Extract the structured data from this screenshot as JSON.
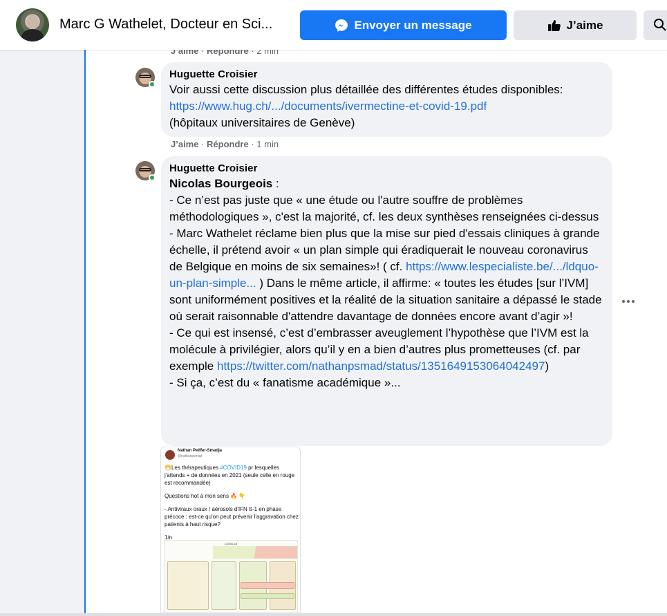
{
  "header": {
    "page_name": "Marc G Wathelet, Docteur en Sci...",
    "message_button": "Envoyer un message",
    "like_button": "J’aime"
  },
  "top_meta": {
    "like": "J’aime",
    "reply": "Répondre",
    "time": "2 min"
  },
  "comments": [
    {
      "author": "Huguette Croisier",
      "text_before_link": "Voir aussi cette discussion plus détaillée des différentes études disponibles: ",
      "link": "https://www.hug.ch/.../documents/ivermectine-et-covid-19.pdf",
      "text_after_link": "(hôpitaux universitaires de Genève)",
      "meta": {
        "like": "J’aime",
        "reply": "Répondre",
        "time": "1 min"
      }
    },
    {
      "author": "Huguette Croisier",
      "mention": "Nicolas Bourgeois",
      "mention_suffix": " :",
      "para1": "- Ce n’est pas juste que « une étude ou l'autre souffre de problèmes méthodologiques », c'est la majorité, cf. les deux synthèses renseignées ci-dessus",
      "para2_before_link": "- Marc Wathelet réclame bien plus que la mise sur pied d'essais cliniques à grande échelle, il prétend avoir « un plan simple qui éradiquerait le nouveau coronavirus de Belgique en moins de six semaines»! ( cf. ",
      "para2_link": "https://www.lespecialiste.be/.../ldquo-un-plan-simple...",
      "para2_after_link": " ) Dans le même article, il affirme: « toutes les études [sur l’IVM] sont uniformément positives et la réalité de la situation sanitaire a dépassé le stade où serait raisonnable d'attendre davantage de données encore avant d’agir »!",
      "para3_before_link": "- Ce qui est insensé, c’est d’embrasser aveuglement l’hypothèse que l’IVM est la molécule à privilégier, alors qu’il y en a bien d’autres plus prometteuses (cf. par exemple ",
      "para3_link": "https://twitter.com/nathanpsmad/status/1351649153064042497",
      "para3_after_link": ")",
      "para4": "- Si ça, c’est du « fanatisme académique »..."
    }
  ],
  "tweet_preview": {
    "name": "Nathan Peiffer-Smadja",
    "handle": "@nathanpsmad",
    "text1_prefix": "😷Les thérapeutiques ",
    "hashtag": "#COVID19",
    "text1_suffix": " pr lesquelles j'attends + de données en 2021 (seule celle en rouge est recommandée)",
    "text2": "Questions hot à mon sens 🔥 👇",
    "text3": "- Antiviraux oraux / aérosols d'IFN ß-1 en phase précoce : est-ce qu'on peut prévenir l'aggravation chez patients à haut risque?",
    "text4": "1/n",
    "chart_title": "COVID-19"
  }
}
